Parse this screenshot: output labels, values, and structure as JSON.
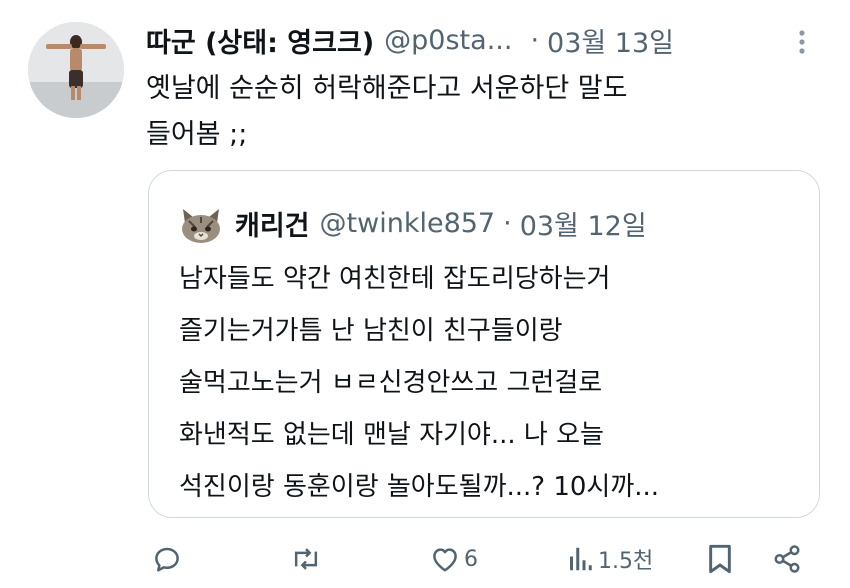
{
  "post": {
    "author_name": "따군 (상태: 영크크)",
    "author_handle": "@p0sta...",
    "separator": "·",
    "date": "03월 13일",
    "text": "옛날에 순순히 허락해준다고 서운하단 말도\n들어봄 ;;"
  },
  "quoted_post": {
    "author_name": "캐리건",
    "author_handle": "@twinkle857",
    "separator": "·",
    "date": "03월 12일",
    "text": "남자들도 약간 여친한테 잡도리당하는거\n즐기는거가틈 난 남친이 친구들이랑\n술먹고노는거 ㅂㄹ신경안쓰고 그런걸로\n화낸적도 없는데 맨날 자기야... 나 오늘\n석진이랑 동훈이랑 놀아도될까...? 10시까..."
  },
  "actions": {
    "reply": {
      "icon": "reply-icon",
      "count": ""
    },
    "repost": {
      "icon": "repost-icon",
      "count": ""
    },
    "like": {
      "icon": "heart-icon",
      "count": "6"
    },
    "views": {
      "icon": "views-icon",
      "count": "1.5천"
    },
    "bookmark": {
      "icon": "bookmark-icon"
    },
    "share": {
      "icon": "share-icon"
    }
  },
  "colors": {
    "text_primary": "#0f1419",
    "text_secondary": "#536471",
    "border": "#cfd9de"
  }
}
